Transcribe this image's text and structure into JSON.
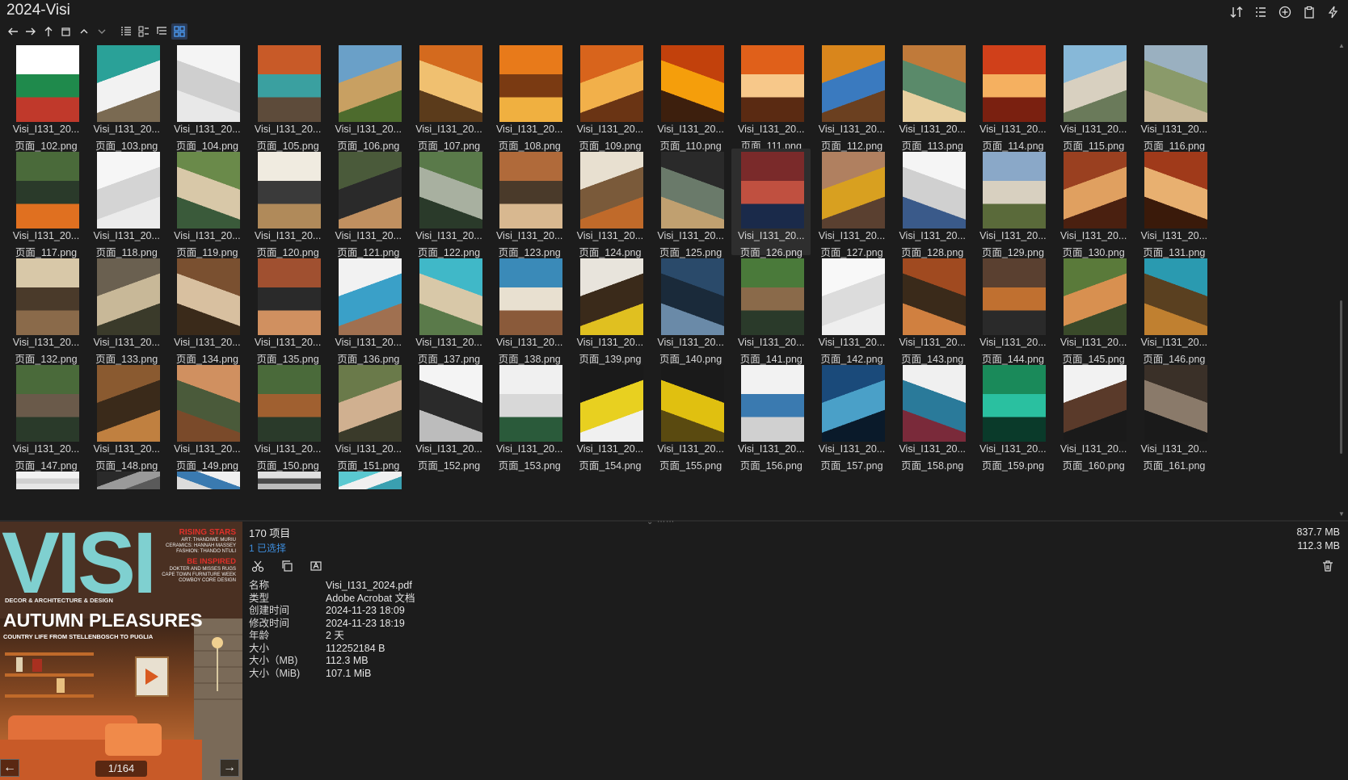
{
  "window": {
    "title": "2024-Visi"
  },
  "toolbar": {
    "icons": [
      "back-arrow-icon",
      "forward-arrow-icon",
      "up-arrow-icon",
      "new-window-icon",
      "chevron-up-icon",
      "chevron-down-icon",
      "list-view-icon",
      "detail-view-icon",
      "tree-view-icon",
      "grid-view-icon"
    ]
  },
  "top_right_icons": [
    "sort-icon",
    "list-icon",
    "add-circle-icon",
    "clipboard-icon",
    "flash-icon"
  ],
  "grid": {
    "items": [
      {
        "l1": "Visi_I131_20...",
        "l2": "页面_102.png",
        "palette": [
          "#ffffff",
          "#1f8a4c",
          "#c0392b"
        ]
      },
      {
        "l1": "Visi_I131_20...",
        "l2": "页面_103.png",
        "palette": [
          "#2aa198",
          "#f2f2f2",
          "#7a6a52"
        ]
      },
      {
        "l1": "Visi_I131_20...",
        "l2": "页面_104.png",
        "palette": [
          "#f4f4f4",
          "#cfcfcf",
          "#e8e8e8"
        ]
      },
      {
        "l1": "Visi_I131_20...",
        "l2": "页面_105.png",
        "palette": [
          "#c85a28",
          "#3aa0a0",
          "#5d4b3a"
        ]
      },
      {
        "l1": "Visi_I131_20...",
        "l2": "页面_106.png",
        "palette": [
          "#6aa0c8",
          "#c8a062",
          "#4d6b2d"
        ]
      },
      {
        "l1": "Visi_I131_20...",
        "l2": "页面_107.png",
        "palette": [
          "#d46a1e",
          "#f0c070",
          "#5b3b1b"
        ]
      },
      {
        "l1": "Visi_I131_20...",
        "l2": "页面_108.png",
        "palette": [
          "#e87a1a",
          "#7a3a12",
          "#f0b040"
        ]
      },
      {
        "l1": "Visi_I131_20...",
        "l2": "页面_109.png",
        "palette": [
          "#d8641c",
          "#f2b04a",
          "#6a3414"
        ]
      },
      {
        "l1": "Visi_I131_20...",
        "l2": "页面_110.png",
        "palette": [
          "#c2410c",
          "#f59e0b",
          "#3d1f0d"
        ]
      },
      {
        "l1": "Visi_I131_20...",
        "l2": "页面_111.png",
        "palette": [
          "#e0601a",
          "#f7c88a",
          "#5a2a12"
        ]
      },
      {
        "l1": "Visi_I131_20...",
        "l2": "页面_112.png",
        "palette": [
          "#d9861c",
          "#3a7abf",
          "#6b4020"
        ]
      },
      {
        "l1": "Visi_I131_20...",
        "l2": "页面_113.png",
        "palette": [
          "#c07a3a",
          "#5a8a6a",
          "#e8d0a0"
        ]
      },
      {
        "l1": "Visi_I131_20...",
        "l2": "页面_114.png",
        "palette": [
          "#d0401a",
          "#f5b060",
          "#7a2010"
        ]
      },
      {
        "l1": "Visi_I131_20...",
        "l2": "页面_115.png",
        "palette": [
          "#87b8d8",
          "#d8d0c0",
          "#6a7a5a"
        ]
      },
      {
        "l1": "Visi_I131_20...",
        "l2": "页面_116.png",
        "palette": [
          "#9ab0c0",
          "#8a9a6a",
          "#c8b898"
        ]
      },
      {
        "l1": "Visi_I131_20...",
        "l2": "页面_117.png",
        "palette": [
          "#4a6a3a",
          "#2a3a2a",
          "#e07020"
        ]
      },
      {
        "l1": "Visi_I131_20...",
        "l2": "页面_118.png",
        "palette": [
          "#f6f6f6",
          "#d4d4d4",
          "#ebebeb"
        ]
      },
      {
        "l1": "Visi_I131_20...",
        "l2": "页面_119.png",
        "palette": [
          "#6a8a4a",
          "#d8c8a8",
          "#3a5a3a"
        ]
      },
      {
        "l1": "Visi_I131_20...",
        "l2": "页面_120.png",
        "palette": [
          "#f0ebe0",
          "#3a3a3a",
          "#b08a5a"
        ]
      },
      {
        "l1": "Visi_I131_20...",
        "l2": "页面_121.png",
        "palette": [
          "#4a5a3a",
          "#2a2a2a",
          "#c09060"
        ]
      },
      {
        "l1": "Visi_I131_20...",
        "l2": "页面_122.png",
        "palette": [
          "#5a7a4a",
          "#a8b0a0",
          "#2a3a2a"
        ]
      },
      {
        "l1": "Visi_I131_20...",
        "l2": "页面_123.png",
        "palette": [
          "#b06a3a",
          "#4a3a2a",
          "#d8b890"
        ]
      },
      {
        "l1": "Visi_I131_20...",
        "l2": "页面_124.png",
        "palette": [
          "#e8e0d0",
          "#7a5a3a",
          "#c06a2a"
        ]
      },
      {
        "l1": "Visi_I131_20...",
        "l2": "页面_125.png",
        "palette": [
          "#2a2a2a",
          "#6a7a6a",
          "#c0a070"
        ]
      },
      {
        "l1": "Visi_I131_20...",
        "l2": "页面_126.png",
        "palette": [
          "#7a2a2a",
          "#c05040",
          "#1a2a4a"
        ],
        "selected": true
      },
      {
        "l1": "Visi_I131_20...",
        "l2": "页面_127.png",
        "palette": [
          "#b08060",
          "#d8a020",
          "#5a4030"
        ]
      },
      {
        "l1": "Visi_I131_20...",
        "l2": "页面_128.png",
        "palette": [
          "#f5f5f5",
          "#d0d0d0",
          "#3a5a8a"
        ]
      },
      {
        "l1": "Visi_I131_20...",
        "l2": "页面_129.png",
        "palette": [
          "#8aa8c8",
          "#d8d0c0",
          "#5a6a3a"
        ]
      },
      {
        "l1": "Visi_I131_20...",
        "l2": "页面_130.png",
        "palette": [
          "#9a4020",
          "#e0a060",
          "#4a2010"
        ]
      },
      {
        "l1": "Visi_I131_20...",
        "l2": "页面_131.png",
        "palette": [
          "#a03a1a",
          "#e8b070",
          "#3a1a0a"
        ]
      },
      {
        "l1": "Visi_I131_20...",
        "l2": "页面_132.png",
        "palette": [
          "#d8c8a8",
          "#4a3a2a",
          "#8a6a4a"
        ]
      },
      {
        "l1": "Visi_I131_20...",
        "l2": "页面_133.png",
        "palette": [
          "#6a6050",
          "#c8b898",
          "#3a3a2a"
        ]
      },
      {
        "l1": "Visi_I131_20...",
        "l2": "页面_134.png",
        "palette": [
          "#7a5030",
          "#d8c0a0",
          "#3a2a1a"
        ]
      },
      {
        "l1": "Visi_I131_20...",
        "l2": "页面_135.png",
        "palette": [
          "#a05030",
          "#2a2a2a",
          "#d09060"
        ]
      },
      {
        "l1": "Visi_I131_20...",
        "l2": "页面_136.png",
        "palette": [
          "#f2f2f2",
          "#3aa0c8",
          "#a07050"
        ]
      },
      {
        "l1": "Visi_I131_20...",
        "l2": "页面_137.png",
        "palette": [
          "#40b8c8",
          "#d8c8a8",
          "#5a7a4a"
        ]
      },
      {
        "l1": "Visi_I131_20...",
        "l2": "页面_138.png",
        "palette": [
          "#3a8ab8",
          "#e8e0d0",
          "#8a5a3a"
        ]
      },
      {
        "l1": "Visi_I131_20...",
        "l2": "页面_139.png",
        "palette": [
          "#e8e4dc",
          "#3a2a1a",
          "#e0c020"
        ]
      },
      {
        "l1": "Visi_I131_20...",
        "l2": "页面_140.png",
        "palette": [
          "#2a4a6a",
          "#1a2a3a",
          "#6a8aa8"
        ]
      },
      {
        "l1": "Visi_I131_20...",
        "l2": "页面_141.png",
        "palette": [
          "#4a7a3a",
          "#8a6a4a",
          "#2a3a2a"
        ]
      },
      {
        "l1": "Visi_I131_20...",
        "l2": "页面_142.png",
        "palette": [
          "#f8f8f8",
          "#dcdcdc",
          "#efefef"
        ]
      },
      {
        "l1": "Visi_I131_20...",
        "l2": "页面_143.png",
        "palette": [
          "#a04a20",
          "#3a2a1a",
          "#d08040"
        ]
      },
      {
        "l1": "Visi_I131_20...",
        "l2": "页面_144.png",
        "palette": [
          "#5a4030",
          "#c07030",
          "#2a2a2a"
        ]
      },
      {
        "l1": "Visi_I131_20...",
        "l2": "页面_145.png",
        "palette": [
          "#5a7a3a",
          "#d89050",
          "#3a4a2a"
        ]
      },
      {
        "l1": "Visi_I131_20...",
        "l2": "页面_146.png",
        "palette": [
          "#2a9ab0",
          "#5a4020",
          "#c08030"
        ]
      },
      {
        "l1": "Visi_I131_20...",
        "l2": "页面_147.png",
        "palette": [
          "#4a6a3a",
          "#6a5a4a",
          "#2a3a2a"
        ]
      },
      {
        "l1": "Visi_I131_20...",
        "l2": "页面_148.png",
        "palette": [
          "#8a5a30",
          "#3a2a1a",
          "#c08040"
        ]
      },
      {
        "l1": "Visi_I131_20...",
        "l2": "页面_149.png",
        "palette": [
          "#d09060",
          "#4a5a3a",
          "#7a4a2a"
        ]
      },
      {
        "l1": "Visi_I131_20...",
        "l2": "页面_150.png",
        "palette": [
          "#4a6a3a",
          "#a06030",
          "#2a3a2a"
        ]
      },
      {
        "l1": "Visi_I131_20...",
        "l2": "页面_151.png",
        "palette": [
          "#6a7a4a",
          "#d0b090",
          "#3a3a2a"
        ]
      },
      {
        "l1": "Visi_I131_20...",
        "l2": "页面_152.png",
        "palette": [
          "#f4f4f4",
          "#2a2a2a",
          "#bcbcbc"
        ]
      },
      {
        "l1": "Visi_I131_20...",
        "l2": "页面_153.png",
        "palette": [
          "#f0f0f0",
          "#d8d8d8",
          "#2a5a3a"
        ]
      },
      {
        "l1": "Visi_I131_20...",
        "l2": "页面_154.png",
        "palette": [
          "#1a1a1a",
          "#e8d020",
          "#f0f0f0"
        ]
      },
      {
        "l1": "Visi_I131_20...",
        "l2": "页面_155.png",
        "palette": [
          "#1a1a1a",
          "#e0c010",
          "#5a4a10"
        ]
      },
      {
        "l1": "Visi_I131_20...",
        "l2": "页面_156.png",
        "palette": [
          "#f2f2f2",
          "#3a7ab0",
          "#d0d0d0"
        ]
      },
      {
        "l1": "Visi_I131_20...",
        "l2": "页面_157.png",
        "palette": [
          "#1a4a7a",
          "#4aa0c8",
          "#0a1a2a"
        ]
      },
      {
        "l1": "Visi_I131_20...",
        "l2": "页面_158.png",
        "palette": [
          "#f0f0f0",
          "#2a7a9a",
          "#7a2a3a"
        ]
      },
      {
        "l1": "Visi_I131_20...",
        "l2": "页面_159.png",
        "palette": [
          "#1a8a5a",
          "#2ac0a0",
          "#0a3a2a"
        ]
      },
      {
        "l1": "Visi_I131_20...",
        "l2": "页面_160.png",
        "palette": [
          "#f2f2f2",
          "#5a3a2a",
          "#1a1a1a"
        ]
      },
      {
        "l1": "Visi_I131_20...",
        "l2": "页面_161.png",
        "palette": [
          "#3a3028",
          "#8a7a6a",
          "#1a1a1a"
        ]
      },
      {
        "l1": "",
        "l2": "",
        "palette": [
          "#f2f2f2",
          "#d0d0d0",
          "#e6e6e6"
        ],
        "partial": true
      },
      {
        "l1": "",
        "l2": "",
        "palette": [
          "#2a2a2a",
          "#9a9a9a",
          "#5a5a5a"
        ],
        "partial": true
      },
      {
        "l1": "",
        "l2": "",
        "palette": [
          "#f0f0f0",
          "#3a7ab0",
          "#dcdcdc"
        ],
        "partial": true
      },
      {
        "l1": "",
        "l2": "",
        "palette": [
          "#e0e0e0",
          "#4a4a4a",
          "#bcbcbc"
        ],
        "partial": true
      },
      {
        "l1": "",
        "l2": "",
        "palette": [
          "#5ac8d0",
          "#f0f0f0",
          "#3aa0b0"
        ],
        "partial": true
      }
    ]
  },
  "preview": {
    "logo": "VISI",
    "tagline": "DECOR & ARCHITECTURE & DESIGN",
    "headline": "AUTUMN PLEASURES",
    "subhead": "COUNTRY LIFE FROM STELLENBOSCH TO PUGLIA",
    "rising_stars": "RISING STARS",
    "rising_lines": [
      "ART: THANDIWE MURIU",
      "CERAMICS: HANNAH MASSEY",
      "FASHION: THANDO NTULI"
    ],
    "be_inspired": "BE INSPIRED",
    "inspired_lines": [
      "DOKTER AND MISSES RUGS",
      "CAPE TOWN FURNITURE WEEK",
      "COWBOY CORE DESIGN"
    ],
    "page_indicator": "1/164"
  },
  "info": {
    "item_count": "170 项目",
    "selected_count": "1 已选择",
    "properties": [
      {
        "k": "名称",
        "v": "Visi_I131_2024.pdf"
      },
      {
        "k": "类型",
        "v": "Adobe Acrobat 文档"
      },
      {
        "k": "创建时间",
        "v": "2024-11-23  18:09"
      },
      {
        "k": "修改时间",
        "v": "2024-11-23  18:19"
      },
      {
        "k": "年龄",
        "v": "2 天"
      },
      {
        "k": "大小",
        "v": "112252184 B"
      },
      {
        "k": "大小（MB)",
        "v": "112.3 MB"
      },
      {
        "k": "大小（MiB)",
        "v": "107.1 MiB"
      }
    ],
    "total_size": "837.7 MB",
    "selected_size": "112.3 MB"
  },
  "colors": {
    "background": "#1c1c1c",
    "accent": "#3d8cdb",
    "visi_teal": "#7fd0d0",
    "rising_red": "#e0302a"
  }
}
